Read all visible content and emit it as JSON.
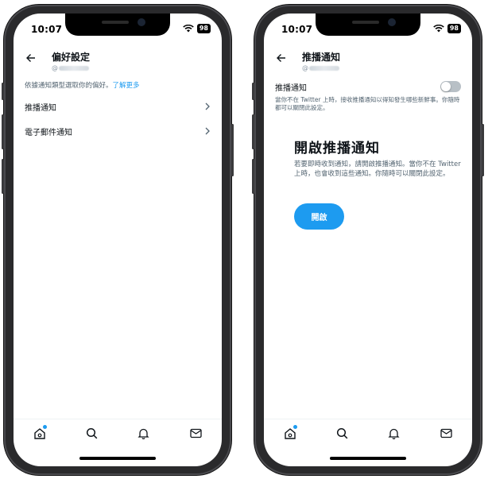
{
  "status": {
    "time": "10:07",
    "battery": "98"
  },
  "left": {
    "title": "偏好設定",
    "handle": "@",
    "description": "依據通知類型選取你的偏好。",
    "learn_more": "了解更多",
    "items": [
      {
        "label": "推播通知"
      },
      {
        "label": "電子郵件通知"
      }
    ]
  },
  "right": {
    "title": "推播通知",
    "handle": "@",
    "toggle_label": "推播通知",
    "toggle_on": false,
    "toggle_note": "當你不在 Twitter 上時，接收推播通知以得知發生哪些新鮮事。你隨時都可以關閉此設定。",
    "big_title": "開啟推播通知",
    "big_body": "若要即時收到通知，請開啟推播通知。當你不在 Twitter 上時，也會收到這些通知。你隨時可以關閉此設定。",
    "button": "開啟"
  },
  "tabbar": [
    "home-icon",
    "search-icon",
    "bell-icon",
    "mail-icon"
  ],
  "colors": {
    "accent": "#1d9bf0",
    "text": "#0f1419",
    "secondary": "#536471"
  }
}
